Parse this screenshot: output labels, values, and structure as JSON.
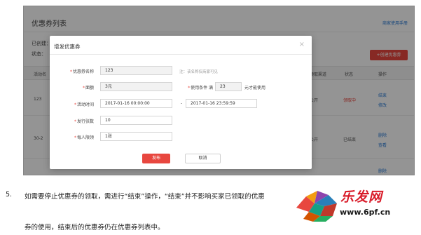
{
  "page": {
    "title": "优惠券列表",
    "help_link": "商家使用手册",
    "filter_created": "已创建：",
    "filter_status": "状态：",
    "create_button": "+创建优惠券"
  },
  "table": {
    "columns": [
      "活动名",
      "领取渠道",
      "状态",
      "操作"
    ],
    "rows": [
      {
        "name": "123",
        "channel": "公开",
        "status": "领取中",
        "actions": [
          "结束",
          "修改"
        ]
      },
      {
        "name": "30-2",
        "channel": "公开",
        "status": "已结束",
        "actions": [
          "删除",
          "查看"
        ]
      },
      {
        "name": "",
        "channel": "",
        "status": "",
        "actions": [
          "删除"
        ]
      }
    ]
  },
  "modal": {
    "title": "增发优惠券",
    "close_icon": "close-icon",
    "fields": {
      "name_label": "优惠券名称",
      "name_value": "123",
      "name_hint": "注：该名称仅商家可见",
      "amount_label": "面额",
      "amount_value": "3元",
      "condition_label": "使用条件 满",
      "condition_value": "23",
      "condition_suffix": "元才能使用",
      "time_label": "活动时间",
      "time_start": "2017-01-16 00:00:00",
      "time_sep": "-",
      "time_end": "2017-01-16 23:59:59",
      "count_label": "发行张数",
      "count_value": "10",
      "limit_label": "每人限领",
      "limit_value": "1张"
    },
    "publish_button": "发布",
    "cancel_button": "取消"
  },
  "article": {
    "step_number": "5.",
    "line1": "如需要停止优惠券的领取，需进行“结束”操作，“结束”并不影响买家已领取的优惠",
    "line2": "券的使用，结束后的优惠券仍在优惠券列表中。"
  },
  "watermark": {
    "brand": "乐发网",
    "url": "www.6pf.cn"
  },
  "colors": {
    "accent_red": "#e8473f",
    "link_blue": "#2b7bd6",
    "watermark_red": "#d91c2a"
  }
}
